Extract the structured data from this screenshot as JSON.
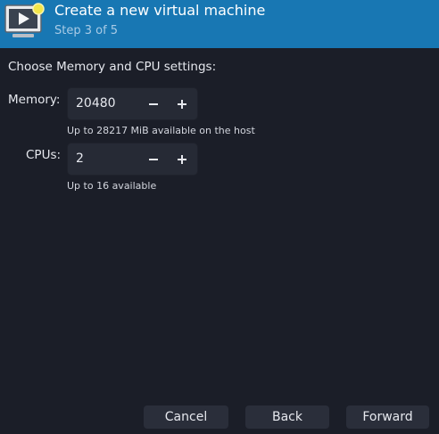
{
  "header": {
    "title": "Create a new virtual machine",
    "subtitle": "Step 3 of 5",
    "icon": "virtual-machine-icon"
  },
  "section_label": "Choose Memory and CPU settings:",
  "memory": {
    "label": "Memory:",
    "value": "20480",
    "hint": "Up to 28217 MiB available on the host"
  },
  "cpus": {
    "label": "CPUs:",
    "value": "2",
    "hint": "Up to 16 available"
  },
  "buttons": {
    "cancel": "Cancel",
    "back": "Back",
    "forward": "Forward"
  },
  "colors": {
    "header_bg": "#1877b3",
    "window_bg": "#1b1e28",
    "field_bg": "#262a35",
    "button_bg": "#2a2e3a"
  }
}
